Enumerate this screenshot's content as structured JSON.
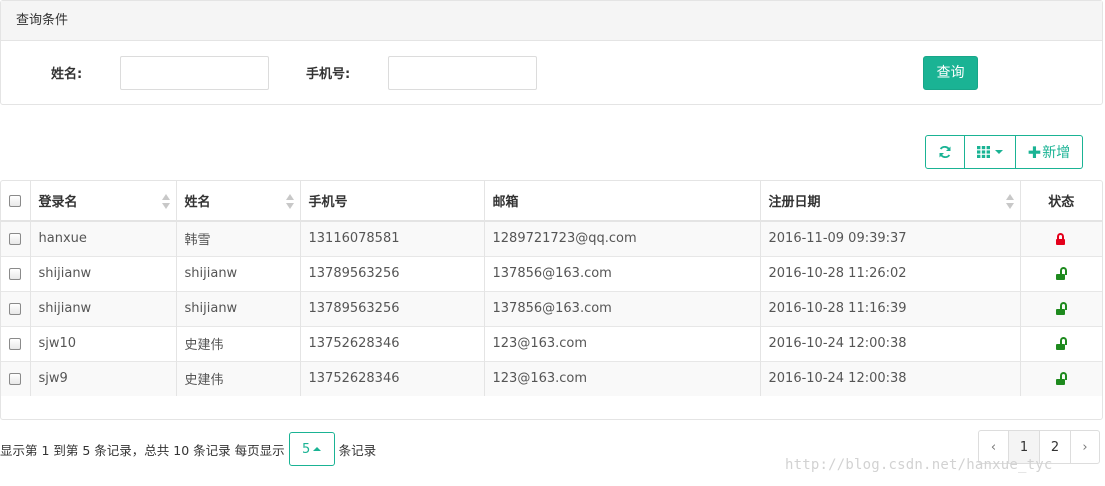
{
  "search_panel": {
    "title": "查询条件",
    "name_label": "姓名:",
    "name_value": "",
    "phone_label": "手机号:",
    "phone_value": "",
    "query_button": "查询"
  },
  "toolbar": {
    "refresh_icon": "refresh-icon",
    "columns_icon": "grid-icon",
    "add_label": "新增"
  },
  "table": {
    "columns": [
      "登录名",
      "姓名",
      "手机号",
      "邮箱",
      "注册日期",
      "状态"
    ],
    "rows": [
      {
        "login": "hanxue",
        "name": "韩雪",
        "phone": "13116078581",
        "email": "1289721723@qq.com",
        "date": "2016-11-09 09:39:37",
        "status": "locked"
      },
      {
        "login": "shijianw",
        "name": "shijianw",
        "phone": "13789563256",
        "email": "137856@163.com",
        "date": "2016-10-28 11:26:02",
        "status": "unlocked"
      },
      {
        "login": "shijianw",
        "name": "shijianw",
        "phone": "13789563256",
        "email": "137856@163.com",
        "date": "2016-10-28 11:16:39",
        "status": "unlocked"
      },
      {
        "login": "sjw10",
        "name": "史建伟",
        "phone": "13752628346",
        "email": "123@163.com",
        "date": "2016-10-24 12:00:38",
        "status": "unlocked"
      },
      {
        "login": "sjw9",
        "name": "史建伟",
        "phone": "13752628346",
        "email": "123@163.com",
        "date": "2016-10-24 12:00:38",
        "status": "unlocked"
      }
    ]
  },
  "footer": {
    "info": "显示第 1 到第 5 条记录，总共 10 条记录 每页显示",
    "page_size": "5",
    "suffix": "条记录",
    "prev": "‹",
    "pages": [
      "1",
      "2"
    ],
    "next": "›",
    "current_page": "1"
  },
  "watermark": "http://blog.csdn.net/hanxue_tyc",
  "colors": {
    "accent": "#1ab394",
    "locked": "#e4001b",
    "unlocked": "#1e8a1e"
  }
}
